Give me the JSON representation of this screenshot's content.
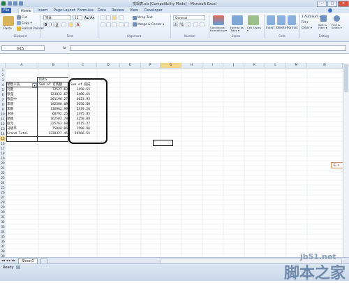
{
  "window": {
    "title": "提现表.xls [Compatibility Mode] - Microsoft Excel",
    "minimize": "–",
    "maximize": "□",
    "close": "✕"
  },
  "tabs": [
    "File",
    "Home",
    "Insert",
    "Page Layout",
    "Formulas",
    "Data",
    "Review",
    "View",
    "Developer"
  ],
  "ribbon": {
    "clipboard": {
      "paste": "Paste",
      "cut": "Cut",
      "copy": "Copy ▾",
      "format_painter": "Format Painter",
      "label": "Clipboard"
    },
    "font": {
      "name": "宋体",
      "size": "12",
      "grow": "A▴",
      "shrink": "A▾",
      "bold": "B",
      "italic": "I",
      "underline": "U",
      "label": "Font"
    },
    "alignment": {
      "wrap_text": "Wrap Text",
      "merge_center": "Merge & Center ▾",
      "label": "Alignment"
    },
    "number": {
      "format": "General",
      "currency": "$",
      "percent": "%",
      "comma": ",",
      "label": "Number"
    },
    "styles": {
      "conditional": "Conditional Formatting ▾",
      "format_table": "Format as Table ▾",
      "cell_styles": "Cell Styles ▾",
      "label": "Styles"
    },
    "cells": {
      "insert": "Insert",
      "delete": "Delete",
      "format": "Format",
      "label": "Cells"
    },
    "editing": {
      "autosum": "Σ AutoSum ▾",
      "fill": "Fill ▾",
      "clear": "Clear ▾",
      "sort_filter": "Sort & Filter ▾",
      "find_select": "Find & Select ▾",
      "label": "Editing"
    }
  },
  "formula_bar": {
    "name_box": "G15",
    "fx": "fx",
    "formula": ""
  },
  "columns": [
    "A",
    "B",
    "C",
    "D",
    "E",
    "F",
    "G",
    "H",
    "I",
    "J",
    "K",
    "L",
    "M",
    "N"
  ],
  "rows": [
    "1",
    "2",
    "3",
    "4",
    "5",
    "6",
    "7",
    "8",
    "9",
    "10",
    "11",
    "12",
    "13",
    "14",
    "15",
    "16",
    "17",
    "18",
    "19",
    "20",
    "21",
    "22",
    "23",
    "24",
    "25",
    "26",
    "27",
    "28",
    "29",
    "30",
    "31",
    "32",
    "33",
    "34",
    "35",
    "36",
    "37",
    "38",
    "39"
  ],
  "pivot": {
    "data_header": "Data",
    "row_label_header": "销售人员",
    "col_b_header": "Sum of 订购额",
    "col_c_header": "Sum of 提成",
    "rows": [
      {
        "name": "刘夏",
        "b": "72527.63",
        "c": "1450.55"
      },
      {
        "name": "张强",
        "b": "123032.67",
        "c": "2460.65"
      },
      {
        "name": "张自中",
        "b": "201196.27",
        "c": "4023.93"
      },
      {
        "name": "李丽",
        "b": "182500.09",
        "c": "3650.00"
      },
      {
        "name": "李鹏",
        "b": "116962.99",
        "c": "2339.26"
      },
      {
        "name": "王琦",
        "b": "68792.25",
        "c": "1375.85"
      },
      {
        "name": "郑峰",
        "b": "162503.78",
        "c": "3250.08"
      },
      {
        "name": "赵元",
        "b": "225763.68",
        "c": "4515.27"
      },
      {
        "name": "马晓平",
        "b": "75048.06",
        "c": "1500.96"
      }
    ],
    "grand_total_label": "Grand Total",
    "grand_total_b": "1228327.45",
    "grand_total_c": "24566.55"
  },
  "sheet_tabs": [
    "Sheet1"
  ],
  "status": {
    "ready": "Ready"
  },
  "side_badge": "中 ѕ",
  "watermark": {
    "site": "jb51.net",
    "name": "脚本之家"
  }
}
